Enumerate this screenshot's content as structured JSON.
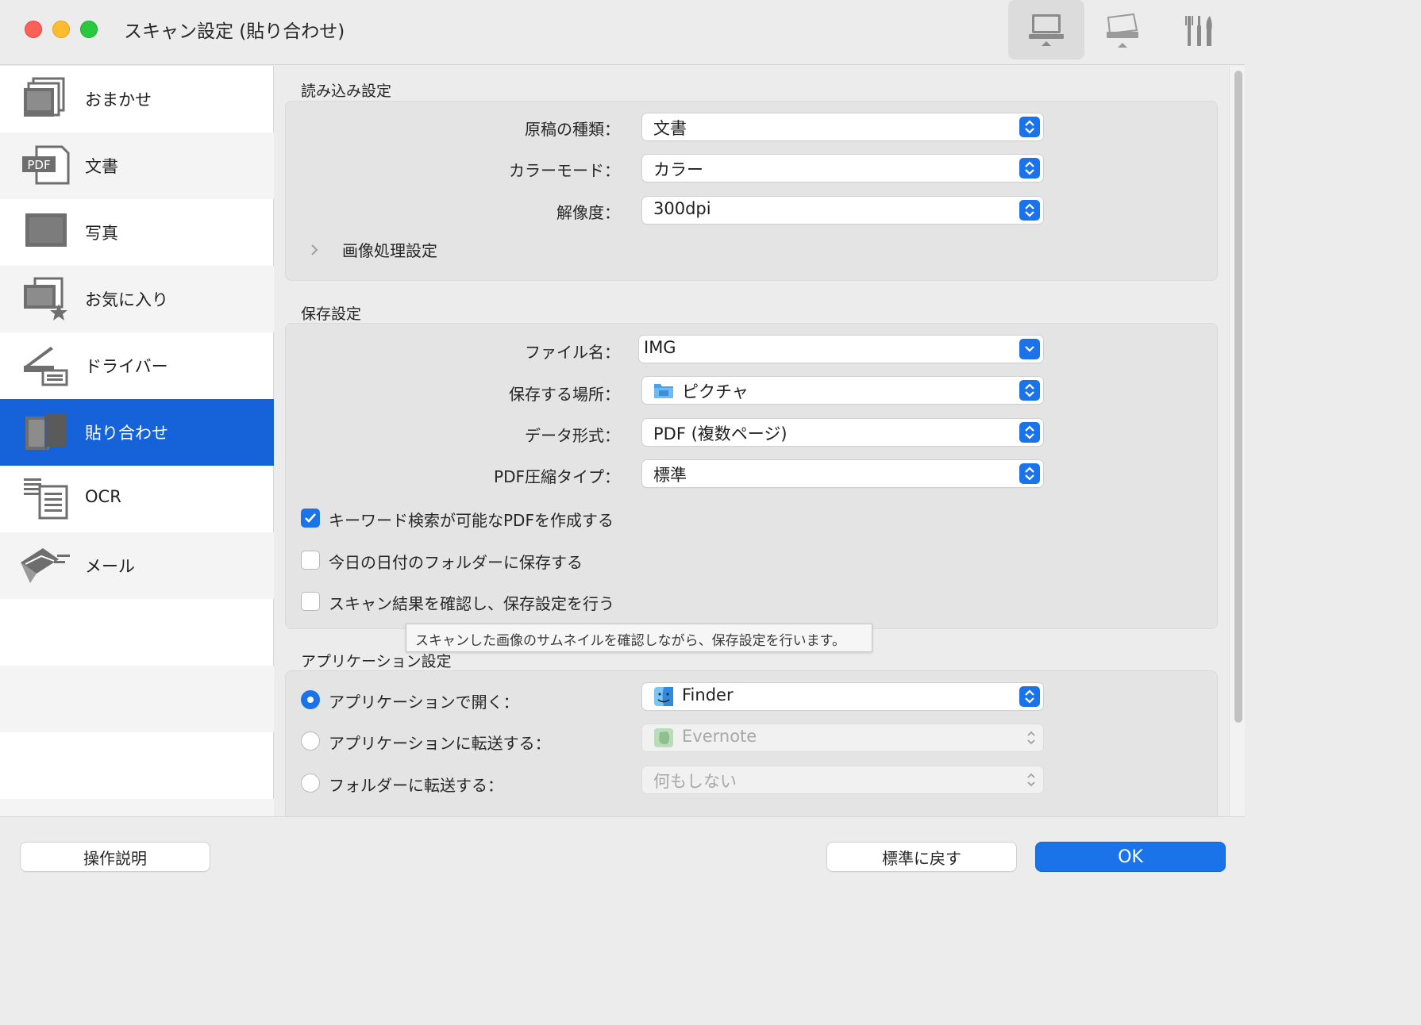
{
  "window": {
    "title": "スキャン設定 (貼り合わせ)",
    "toolbar": [
      {
        "icon": "computer-scan-icon",
        "active": true
      },
      {
        "icon": "scanner-panel-icon",
        "active": false
      },
      {
        "icon": "tools-icon",
        "active": false
      }
    ]
  },
  "sidebar": {
    "items": [
      {
        "label": "おまかせ",
        "icon": "auto-scan-icon"
      },
      {
        "label": "文書",
        "icon": "pdf-document-icon"
      },
      {
        "label": "写真",
        "icon": "photo-icon"
      },
      {
        "label": "お気に入り",
        "icon": "favorites-icon"
      },
      {
        "label": "ドライバー",
        "icon": "scanner-driver-icon"
      },
      {
        "label": "貼り合わせ",
        "icon": "stitch-icon",
        "selected": true
      },
      {
        "label": "OCR",
        "icon": "ocr-icon"
      },
      {
        "label": "メール",
        "icon": "mail-icon"
      }
    ]
  },
  "scan_settings": {
    "title": "読み込み設定",
    "document_type": {
      "label": "原稿の種類：",
      "value": "文書"
    },
    "color_mode": {
      "label": "カラーモード：",
      "value": "カラー"
    },
    "resolution": {
      "label": "解像度：",
      "value": "300dpi"
    },
    "image_processing": {
      "label": "画像処理設定",
      "expanded": false
    }
  },
  "save_settings": {
    "title": "保存設定",
    "file_name": {
      "label": "ファイル名：",
      "value": "IMG"
    },
    "save_location": {
      "label": "保存する場所：",
      "value": "ピクチャ",
      "icon": "folder-icon"
    },
    "data_format": {
      "label": "データ形式：",
      "value": "PDF (複数ページ)"
    },
    "pdf_compression": {
      "label": "PDF圧縮タイプ：",
      "value": "標準"
    },
    "checkboxes": [
      {
        "label": "キーワード検索が可能なPDFを作成する",
        "checked": true
      },
      {
        "label": "今日の日付のフォルダーに保存する",
        "checked": false
      },
      {
        "label": "スキャン結果を確認し、保存設定を行う",
        "checked": false
      }
    ],
    "tooltip": "スキャンした画像のサムネイルを確認しながら、保存設定を行います。"
  },
  "app_settings": {
    "title": "アプリケーション設定",
    "options": [
      {
        "label": "アプリケーションで開く：",
        "selected": true,
        "value": "Finder",
        "icon": "finder-icon",
        "enabled": true
      },
      {
        "label": "アプリケーションに転送する：",
        "selected": false,
        "value": "Evernote",
        "icon": "evernote-icon",
        "enabled": false
      },
      {
        "label": "フォルダーに転送する：",
        "selected": false,
        "value": "何もしない",
        "enabled": false
      }
    ]
  },
  "footer": {
    "instructions_button": "操作説明",
    "defaults_button": "標準に戻す",
    "ok_button": "OK"
  },
  "colors": {
    "accent": "#1a73e8",
    "sidebar_selected": "#1662d8",
    "window_bg": "#ececec"
  }
}
